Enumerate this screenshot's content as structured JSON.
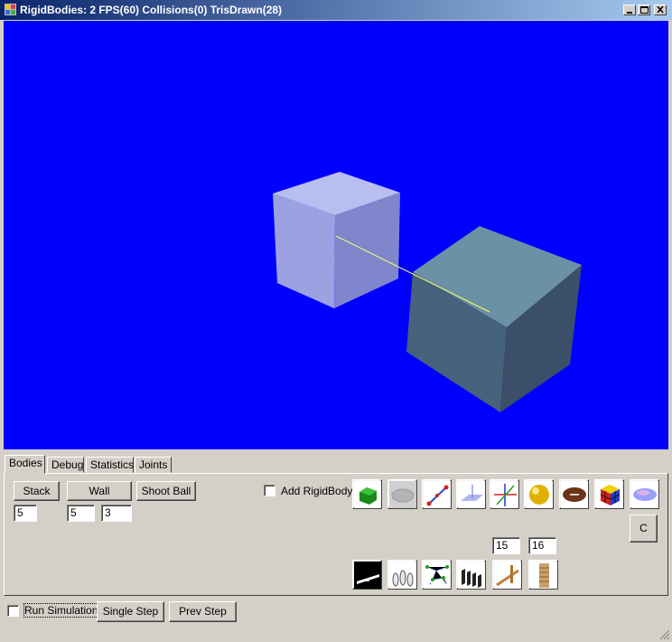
{
  "window": {
    "title": "RigidBodies: 2 FPS(60) Collisions(0) TrisDrawn(28)"
  },
  "viewport": {
    "background": "#0000ff"
  },
  "tabs": [
    "Bodies",
    "Debug",
    "Statistics",
    "Joints"
  ],
  "bodies": {
    "stack_label": "Stack",
    "stack_value": "5",
    "wall_label": "Wall",
    "wall_width": "5",
    "wall_height": "3",
    "shoot_ball_label": "Shoot Ball",
    "add_rigidbody_label": "Add RigidBody",
    "c_label": "C",
    "field_a": "15",
    "field_b": "16"
  },
  "bottom": {
    "run_simulation_label": "Run Simulation",
    "single_step_label": "Single Step",
    "prev_step_label": "Prev Step"
  }
}
